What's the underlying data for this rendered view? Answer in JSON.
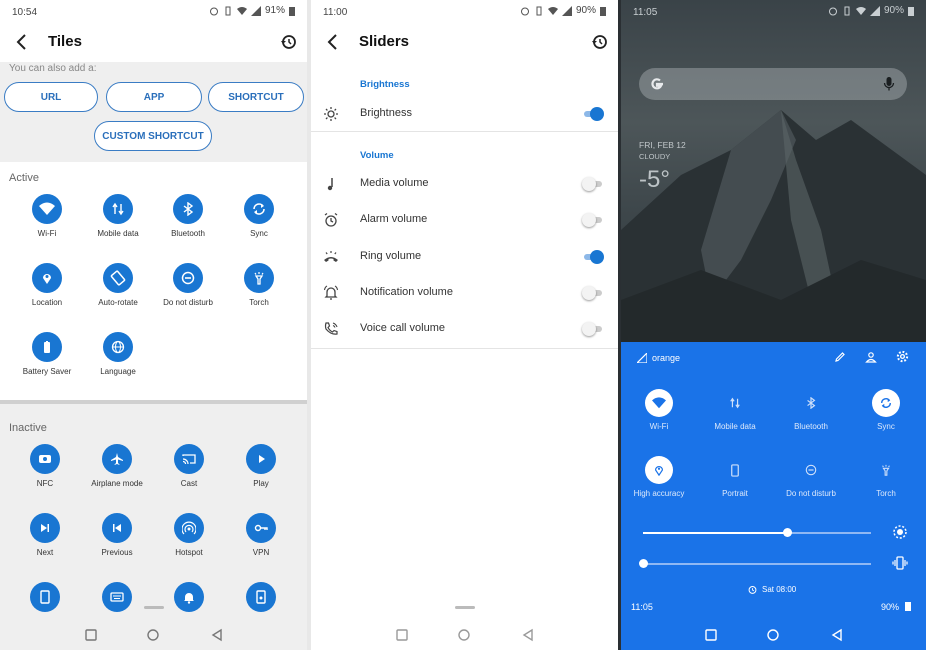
{
  "tiles_screen": {
    "status": {
      "time": "10:54",
      "battery": "91%"
    },
    "title": "Tiles",
    "add_hint": "You can also add a:",
    "buttons": {
      "url": "URL",
      "app": "APP",
      "shortcut": "SHORTCUT",
      "custom_shortcut": "CUSTOM SHORTCUT"
    },
    "active_label": "Active",
    "active": [
      "Wi-Fi",
      "Mobile data",
      "Bluetooth",
      "Sync",
      "Location",
      "Auto-rotate",
      "Do not disturb",
      "Torch",
      "Battery Saver",
      "Language"
    ],
    "inactive_label": "Inactive",
    "inactive": [
      "NFC",
      "Airplane mode",
      "Cast",
      "Play",
      "Next",
      "Previous",
      "Hotspot",
      "VPN"
    ]
  },
  "sliders_screen": {
    "status": {
      "time": "11:00",
      "battery": "90%"
    },
    "title": "Sliders",
    "brightness_header": "Brightness",
    "brightness_label": "Brightness",
    "volume_header": "Volume",
    "volumes": [
      {
        "label": "Media volume",
        "on": false
      },
      {
        "label": "Alarm volume",
        "on": false
      },
      {
        "label": "Ring volume",
        "on": true
      },
      {
        "label": "Notification volume",
        "on": false
      },
      {
        "label": "Voice call volume",
        "on": false
      }
    ],
    "brightness_on": true
  },
  "lock_screen": {
    "status": {
      "time": "11:05",
      "battery": "90%"
    },
    "date": "FRI, FEB 12",
    "condition": "CLOUDY",
    "temperature": "-5°",
    "carrier": "orange",
    "row1": [
      {
        "label": "Wi-Fi",
        "on": true
      },
      {
        "label": "Mobile data",
        "on": false
      },
      {
        "label": "Bluetooth",
        "on": false
      },
      {
        "label": "Sync",
        "on": true
      }
    ],
    "row2": [
      {
        "label": "High accuracy",
        "on": true
      },
      {
        "label": "Portrait",
        "on": false
      },
      {
        "label": "Do not disturb",
        "on": false
      },
      {
        "label": "Torch",
        "on": false
      }
    ],
    "brightness_level": 0.63,
    "vibrate_level": 0.0,
    "alarm": "Sat 08:00",
    "footer_time": "11:05",
    "footer_battery": "90%"
  },
  "colors": {
    "accent": "#1976d2",
    "qs_bg": "#1a73e8"
  }
}
